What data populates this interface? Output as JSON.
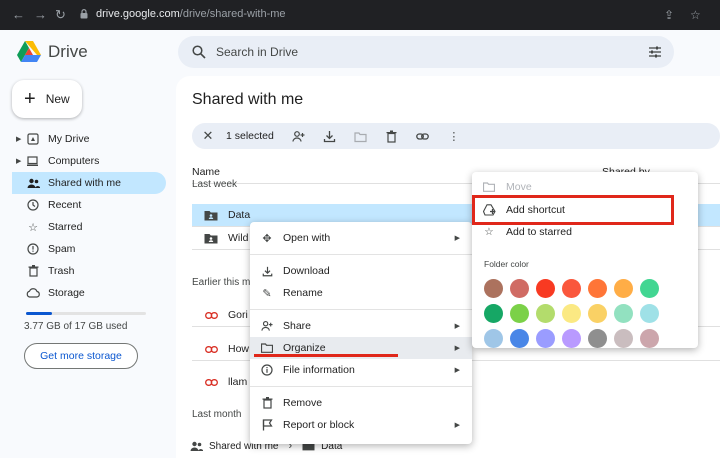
{
  "browser": {
    "url_host": "drive.google.com",
    "url_path": "/drive/shared-with-me"
  },
  "app": {
    "name": "Drive"
  },
  "new_button": {
    "label": "New"
  },
  "sidebar": {
    "items": [
      {
        "label": "My Drive",
        "icon": "my-drive-icon"
      },
      {
        "label": "Computers",
        "icon": "computer-icon"
      },
      {
        "label": "Shared with me",
        "icon": "people-icon",
        "active": true
      },
      {
        "label": "Recent",
        "icon": "clock-icon"
      },
      {
        "label": "Starred",
        "icon": "star-icon"
      },
      {
        "label": "Spam",
        "icon": "spam-icon"
      },
      {
        "label": "Trash",
        "icon": "trash-icon"
      },
      {
        "label": "Storage",
        "icon": "cloud-icon"
      }
    ],
    "storage_used_fraction": 0.22,
    "storage_text": "3.77 GB of 17 GB used",
    "get_more_storage": "Get more storage"
  },
  "search": {
    "placeholder": "Search in Drive"
  },
  "main": {
    "title": "Shared with me",
    "selection_count": "1 selected",
    "columns": {
      "name": "Name",
      "shared_by": "Shared by"
    },
    "sections": {
      "last_week": "Last week",
      "earlier_this_month": "Earlier this m",
      "last_month": "Last month"
    },
    "rows": [
      {
        "name": "Data",
        "type": "shared-folder",
        "selected": true
      },
      {
        "name": "Wild",
        "type": "shared-folder"
      },
      {
        "name": "Gori",
        "type": "link"
      },
      {
        "name": "How",
        "type": "link"
      },
      {
        "name": "llam",
        "type": "link"
      }
    ],
    "breadcrumb": {
      "root": "Shared with me",
      "current": "Data"
    }
  },
  "context_menu": {
    "open_with": "Open with",
    "download": "Download",
    "rename": "Rename",
    "share": "Share",
    "organize": "Organize",
    "file_information": "File information",
    "remove": "Remove",
    "report_or_block": "Report or block"
  },
  "submenu": {
    "move": "Move",
    "add_shortcut": "Add shortcut",
    "add_to_starred": "Add to starred",
    "folder_color": "Folder color",
    "colors": [
      "#ac725e",
      "#d06b64",
      "#f83a22",
      "#fa573c",
      "#ff7537",
      "#ffad46",
      "#42d692",
      "#16a765",
      "#7bd148",
      "#b3dc6c",
      "#fbe983",
      "#fad165",
      "#92e1c0",
      "#9fe1e7",
      "#9fc6e7",
      "#4986e7",
      "#9a9cff",
      "#b99aff",
      "#8f8f8f",
      "#cabdbf",
      "#cca6ac"
    ]
  },
  "colors": {
    "highlight": "#e0271a",
    "selected_row": "#c2e7ff",
    "accent": "#0b57d0"
  }
}
